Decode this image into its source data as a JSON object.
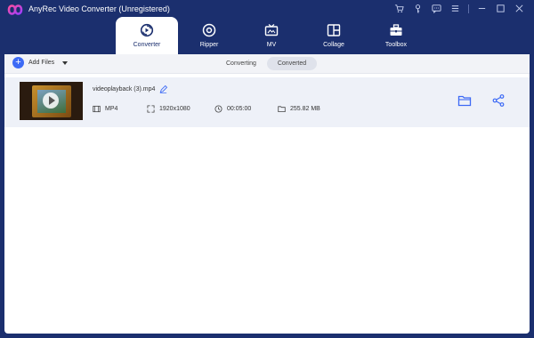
{
  "window": {
    "title": "AnyRec Video Converter (Unregistered)"
  },
  "title_controls": [
    {
      "name": "cart-icon"
    },
    {
      "name": "key-icon"
    },
    {
      "name": "feedback-icon"
    },
    {
      "name": "menu-icon"
    },
    {
      "name": "minimize-icon"
    },
    {
      "name": "maximize-icon"
    },
    {
      "name": "close-icon"
    }
  ],
  "tabs": [
    {
      "label": "Converter",
      "icon": "converter-icon",
      "active": true
    },
    {
      "label": "Ripper",
      "icon": "disc-icon",
      "active": false
    },
    {
      "label": "MV",
      "icon": "tv-icon",
      "active": false
    },
    {
      "label": "Collage",
      "icon": "collage-icon",
      "active": false
    },
    {
      "label": "Toolbox",
      "icon": "toolbox-icon",
      "active": false
    }
  ],
  "toolbar": {
    "add_files_label": "Add Files",
    "status_tabs": [
      {
        "label": "Converting",
        "active": false
      },
      {
        "label": "Converted",
        "active": true
      }
    ]
  },
  "file": {
    "name": "videoplayback (3).mp4",
    "format": "MP4",
    "resolution": "1920x1080",
    "duration": "00:05:00",
    "size": "255.82 MB"
  },
  "colors": {
    "frame": "#1b2f6e",
    "accent": "#3d6af5",
    "row_bg": "#eef1f8"
  }
}
